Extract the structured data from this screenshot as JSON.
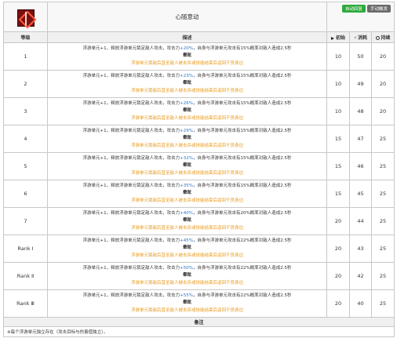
{
  "skill": {
    "name": "心随意动",
    "badges": [
      "自动回复",
      "手动触发"
    ]
  },
  "columns": {
    "level": "等级",
    "description": "描述",
    "initial": "初始",
    "cost": "消耗",
    "duration": "持续"
  },
  "rows": [
    {
      "level": "1",
      "l1_a": "浮游单元+1，释放浮游单元锁定敌人攻击，攻击力",
      "atk": "+20%",
      "l1_b": "，自身与浮游单元攻击有15%概率对敌人造成2.5秒",
      "l2": "晕眩",
      "l3": "浮游单元锁敌后直至敌人被击杀或技能结束后返回干员身边",
      "initial": "10",
      "cost": "50",
      "duration": "20"
    },
    {
      "level": "2",
      "l1_a": "浮游单元+1，释放浮游单元锁定敌人攻击，攻击力",
      "atk": "+23%",
      "l1_b": "，自身与浮游单元攻击有15%概率对敌人造成2.5秒",
      "l2": "晕眩",
      "l3": "浮游单元锁敌后直至敌人被击杀或技能结束后返回干员身边",
      "initial": "10",
      "cost": "49",
      "duration": "20"
    },
    {
      "level": "3",
      "l1_a": "浮游单元+1，释放浮游单元锁定敌人攻击，攻击力",
      "atk": "+26%",
      "l1_b": "，自身与浮游单元攻击有15%概率对敌人造成2.5秒",
      "l2": "晕眩",
      "l3": "浮游单元锁敌后直至敌人被击杀或技能结束后返回干员身边",
      "initial": "10",
      "cost": "48",
      "duration": "20"
    },
    {
      "level": "4",
      "l1_a": "浮游单元+1，释放浮游单元锁定敌人攻击，攻击力",
      "atk": "+29%",
      "l1_b": "，自身与浮游单元攻击有15%概率对敌人造成2.5秒",
      "l2": "晕眩",
      "l3": "浮游单元锁敌后直至敌人被击杀或技能结束后返回干员身边",
      "initial": "15",
      "cost": "47",
      "duration": "25"
    },
    {
      "level": "5",
      "l1_a": "浮游单元+1，释放浮游单元锁定敌人攻击，攻击力",
      "atk": "+32%",
      "l1_b": "，自身与浮游单元攻击有15%概率对敌人造成2.5秒",
      "l2": "晕眩",
      "l3": "浮游单元锁敌后直至敌人被击杀或技能结束后返回干员身边",
      "initial": "15",
      "cost": "46",
      "duration": "25"
    },
    {
      "level": "6",
      "l1_a": "浮游单元+1，释放浮游单元锁定敌人攻击，攻击力",
      "atk": "+35%",
      "l1_b": "，自身与浮游单元攻击有15%概率对敌人造成2.5秒",
      "l2": "晕眩",
      "l3": "浮游单元锁敌后直至敌人被击杀或技能结束后返回干员身边",
      "initial": "15",
      "cost": "45",
      "duration": "25"
    },
    {
      "level": "7",
      "l1_a": "浮游单元+1，释放浮游单元锁定敌人攻击，攻击力",
      "atk": "+40%",
      "l1_b": "，自身与浮游单元攻击有20%概率对敌人造成2.5秒",
      "l2": "晕眩",
      "l3": "浮游单元锁敌后直至敌人被击杀或技能结束后返回干员身边",
      "initial": "20",
      "cost": "44",
      "duration": "25"
    },
    {
      "level": "Rank Ⅰ",
      "l1_a": "浮游单元+1，释放浮游单元锁定敌人攻击，攻击力",
      "atk": "+45%",
      "l1_b": "，自身与浮游单元攻击有22%概率对敌人造成2.5秒",
      "l2": "晕眩",
      "l3": "浮游单元锁敌后直至敌人被击杀或技能结束后返回干员身边",
      "initial": "20",
      "cost": "43",
      "duration": "25"
    },
    {
      "level": "Rank Ⅱ",
      "l1_a": "浮游单元+1，释放浮游单元锁定敌人攻击，攻击力",
      "atk": "+50%",
      "l1_b": "，自身与浮游单元攻击有22%概率对敌人造成2.5秒",
      "l2": "晕眩",
      "l3": "浮游单元锁敌后直至敌人被击杀或技能结束后返回干员身边",
      "initial": "20",
      "cost": "42",
      "duration": "25"
    },
    {
      "level": "Rank Ⅲ",
      "l1_a": "浮游单元+1，释放浮游单元锁定敌人攻击，攻击力",
      "atk": "+55%",
      "l1_b": "，自身与浮游单元攻击有22%概率对敌人造成2.5秒",
      "l2": "晕眩",
      "l3": "浮游单元锁敌后直至敌人被击杀或技能结束后返回干员身边",
      "initial": "20",
      "cost": "40",
      "duration": "25"
    }
  ],
  "notes": {
    "header": "备注",
    "text": "※每个浮游单元独立存在（攻击目标与伤害值独立）。"
  },
  "colors": {
    "highlight_blue": "#2a78c8",
    "orange_text": "#e89a1a",
    "badge_green": "#2eaa3c",
    "badge_grey": "#6b6b6b"
  }
}
